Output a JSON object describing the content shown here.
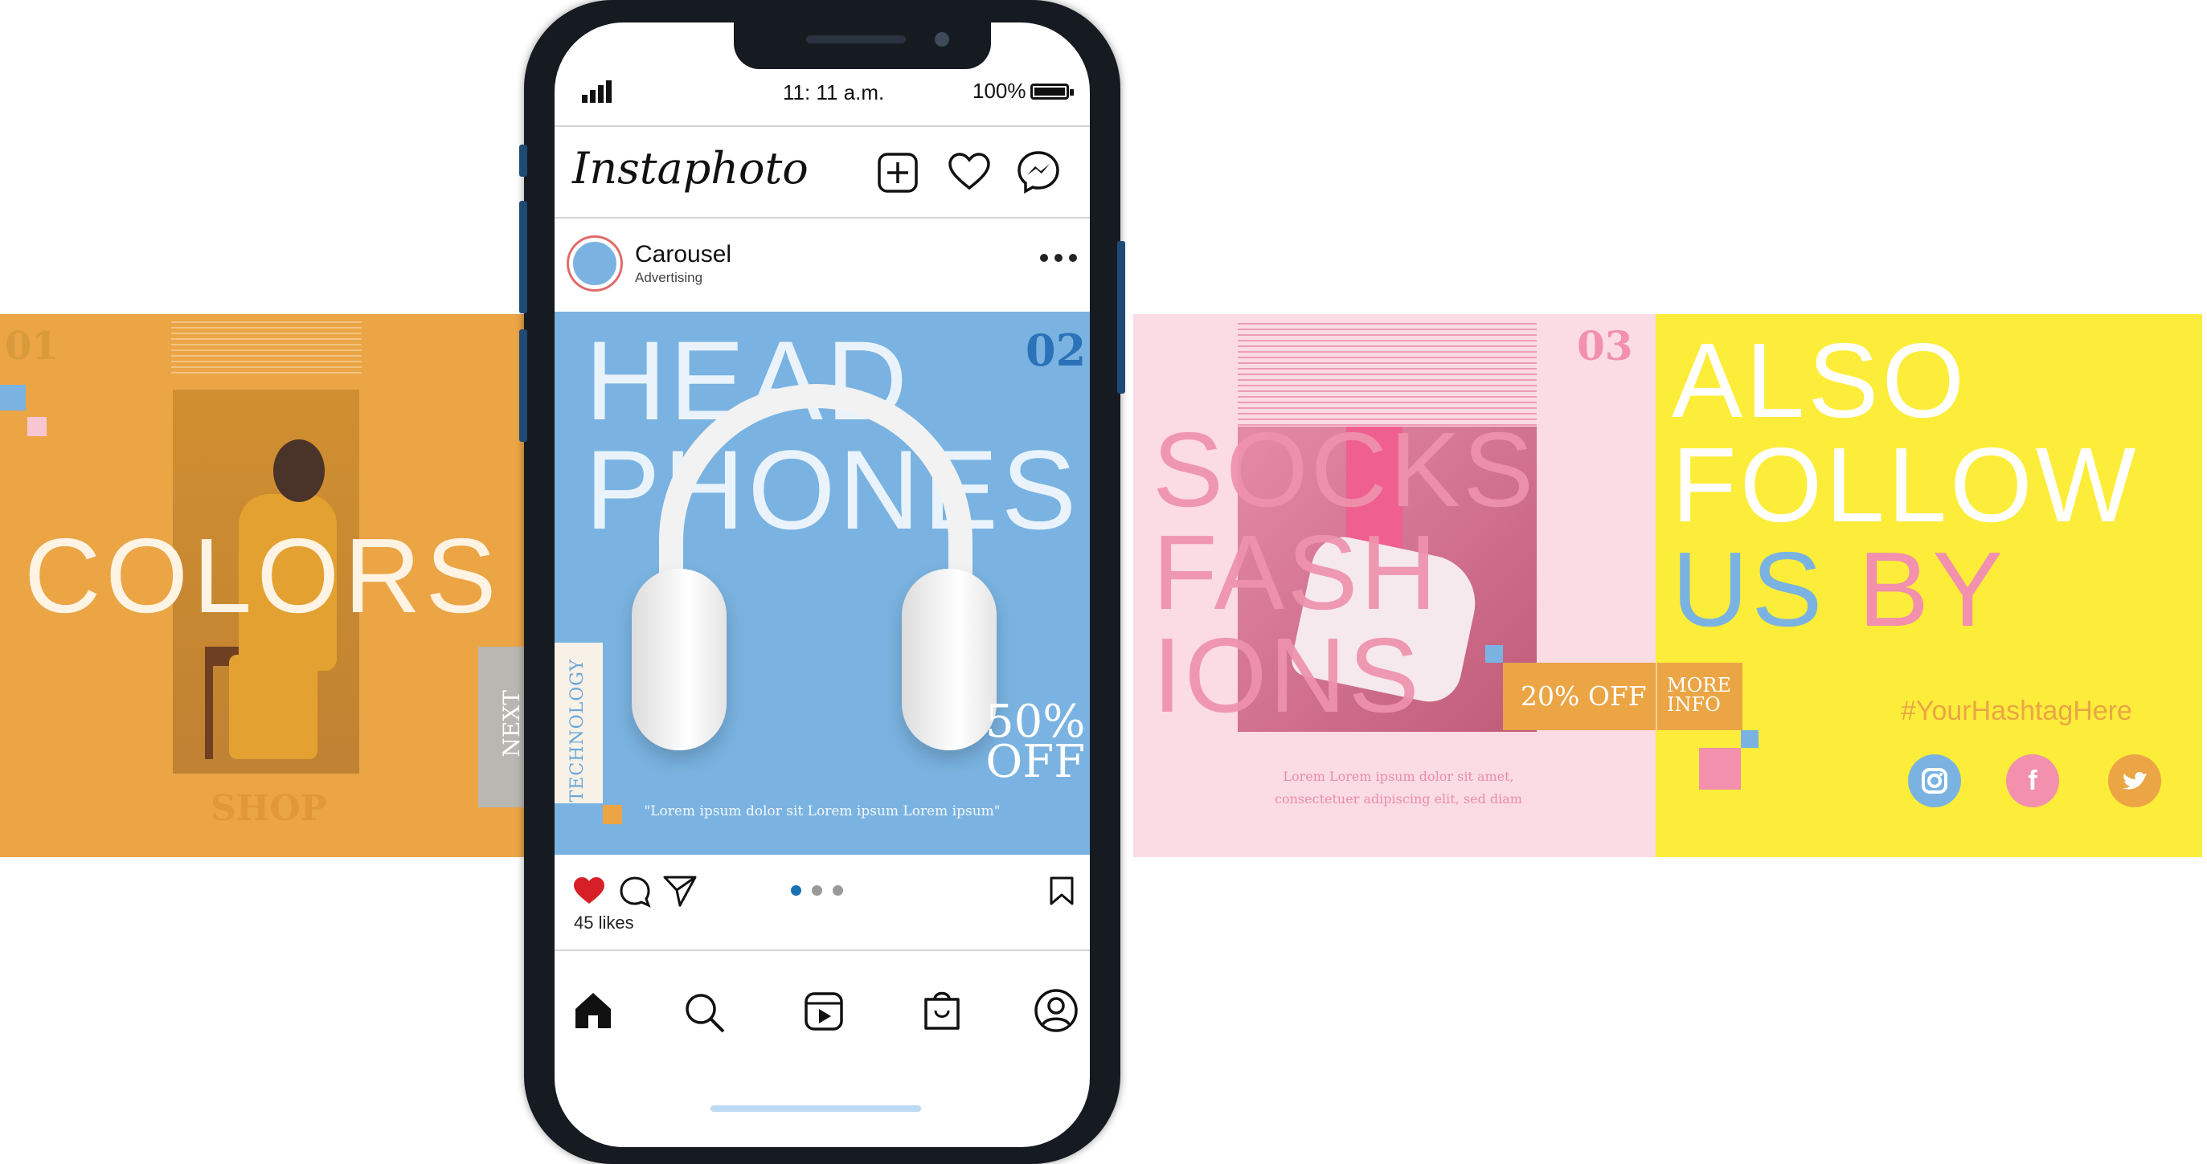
{
  "slide1": {
    "number": "01",
    "title": "COLORS",
    "next_label": "NEXT",
    "shop_label": "SHOP"
  },
  "phone": {
    "status": {
      "time": "11: 11 a.m.",
      "battery": "100%"
    },
    "app": {
      "name": "Instaphoto",
      "icons": [
        "add-post-icon",
        "heart-icon",
        "messenger-icon"
      ]
    },
    "post": {
      "account_name": "Carousel",
      "account_subtitle": "Advertising",
      "slide_number": "02",
      "title_line1": "HEAD",
      "title_line2": "PHONES",
      "side_label": "TECHNOLOGY",
      "discount_line1": "50%",
      "discount_line2": "OFF",
      "quote": "\"Lorem ipsum dolor sit Lorem ipsum Lorem ipsum\"",
      "likes": "45 likes",
      "carousel_pages": 3,
      "carousel_current": 1
    },
    "nav_icons": [
      "home-icon",
      "search-icon",
      "reels-icon",
      "shop-icon",
      "profile-icon"
    ]
  },
  "slide3": {
    "number": "03",
    "title_line1": "SOCKS",
    "title_line2": "FASH",
    "title_line3": "IONS",
    "offer": "20% OFF",
    "more_line1": "MORE",
    "more_line2": "INFO",
    "lorem_line1": "Lorem Lorem ipsum dolor sit amet,",
    "lorem_line2": "consectetuer adipiscing elit, sed diam"
  },
  "slide4": {
    "title_line1": "ALSO",
    "title_line2": "FOLLOW",
    "title_us": "US",
    "title_by": "BY",
    "hashtag": "#YourHashtagHere",
    "social_icons": [
      "instagram-icon",
      "facebook-icon",
      "twitter-icon"
    ]
  },
  "colors": {
    "orange": "#eba545",
    "blue": "#7ab3e1",
    "pink": "#f290ad",
    "light_pink": "#fbdbe4",
    "yellow": "#fced3a",
    "like_red": "#d61f26",
    "active_dot": "#1b6fb5"
  }
}
